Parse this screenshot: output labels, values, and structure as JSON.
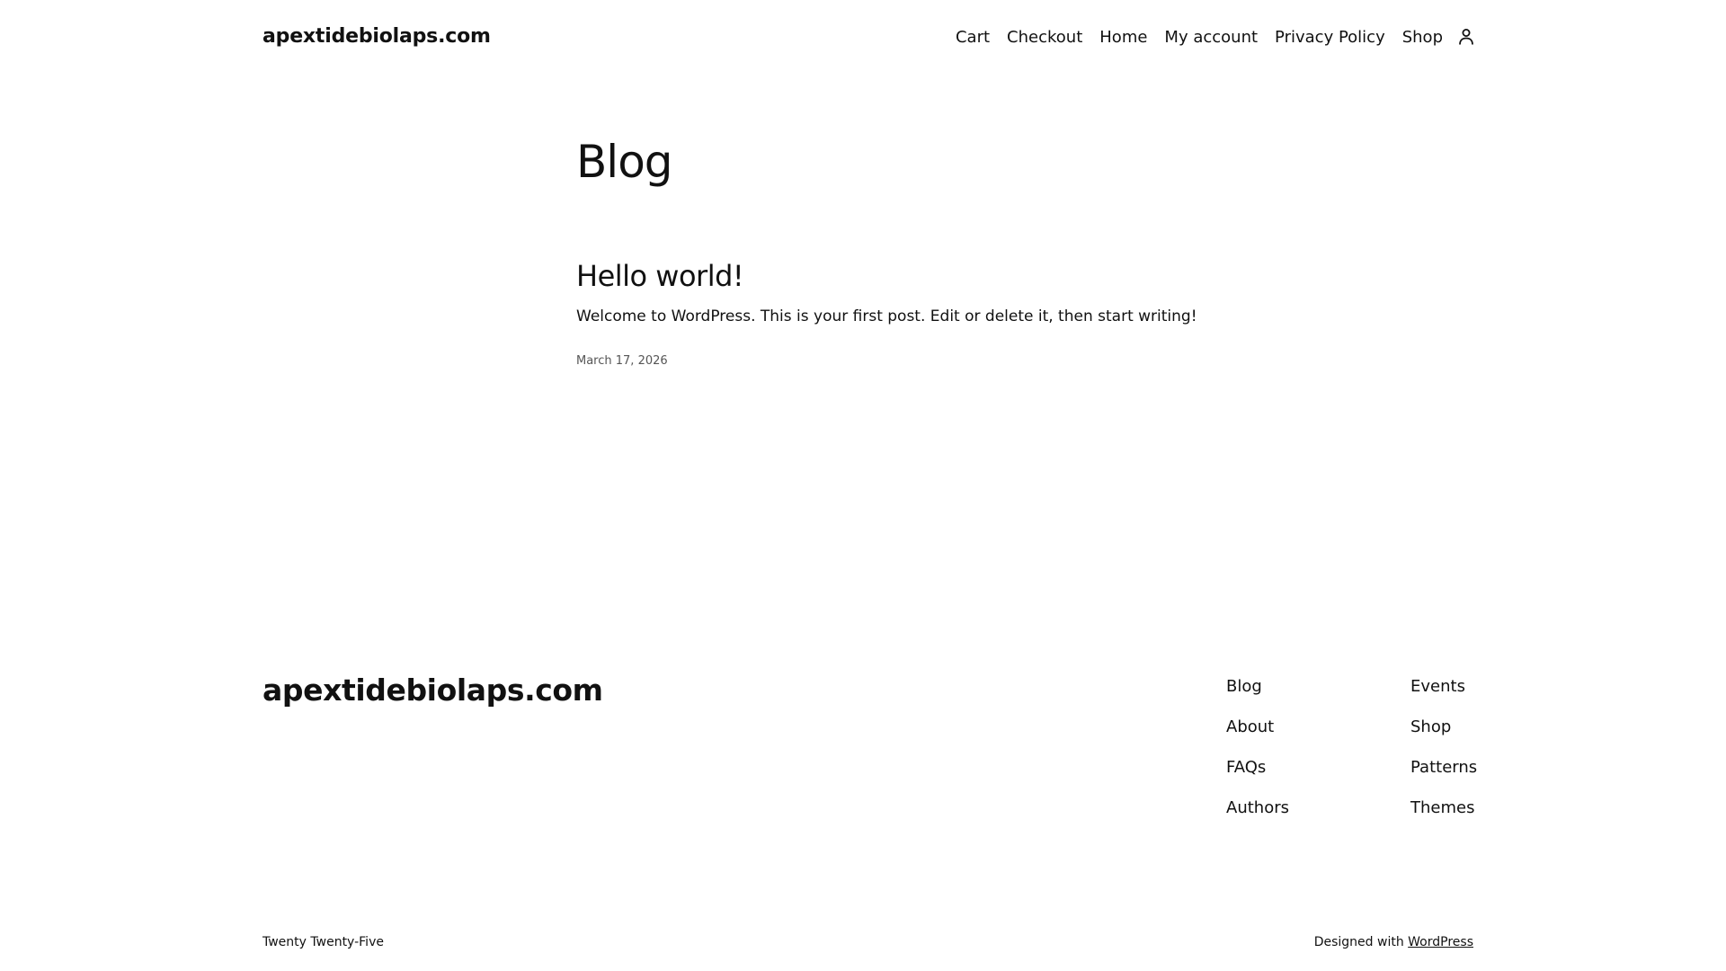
{
  "header": {
    "site_title": "apextidebiolaps.com",
    "nav": [
      {
        "label": "Cart"
      },
      {
        "label": "Checkout"
      },
      {
        "label": "Home"
      },
      {
        "label": "My account"
      },
      {
        "label": "Privacy Policy"
      },
      {
        "label": "Shop"
      }
    ],
    "account_icon": "user-icon"
  },
  "main": {
    "page_title": "Blog",
    "posts": [
      {
        "title": "Hello world!",
        "excerpt": "Welcome to WordPress. This is your first post. Edit or delete it, then start writing!",
        "date": "March 17, 2026"
      }
    ]
  },
  "footer": {
    "site_title": "apextidebiolaps.com",
    "col1": [
      {
        "label": "Blog"
      },
      {
        "label": "About"
      },
      {
        "label": "FAQs"
      },
      {
        "label": "Authors"
      }
    ],
    "col2": [
      {
        "label": "Events"
      },
      {
        "label": "Shop"
      },
      {
        "label": "Patterns"
      },
      {
        "label": "Themes"
      }
    ],
    "credit_left": "Twenty Twenty-Five",
    "credit_right_prefix": "Designed with ",
    "credit_right_link": "WordPress"
  }
}
